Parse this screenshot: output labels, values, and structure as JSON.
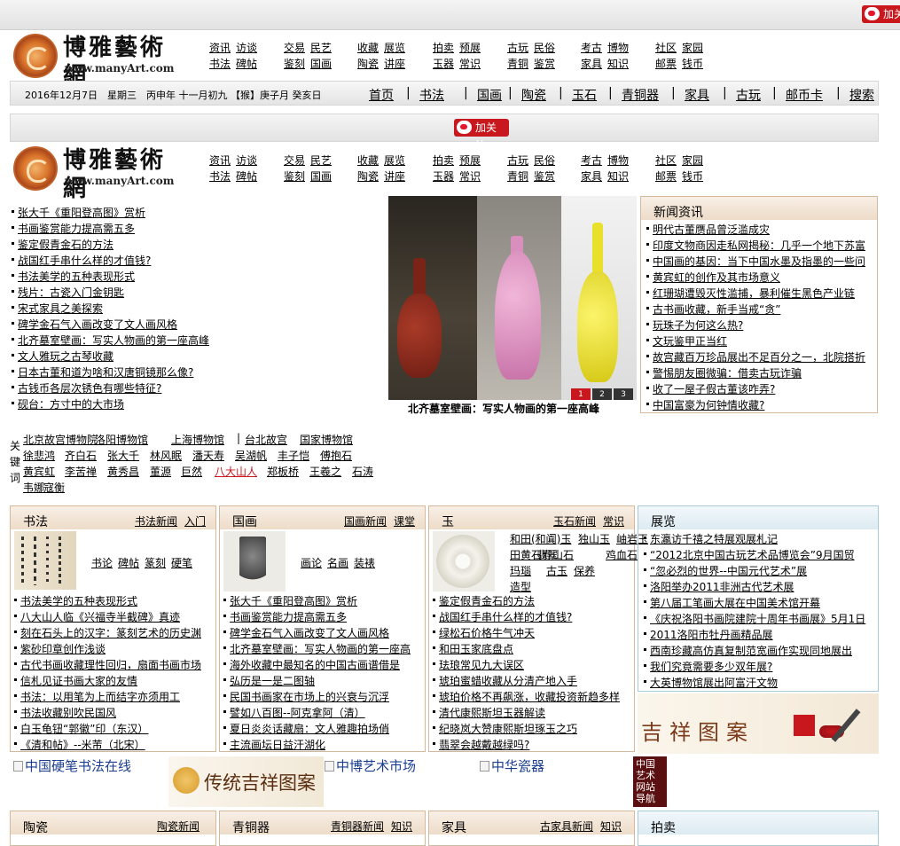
{
  "follow_label": "加关注",
  "follow_label_top": "加关",
  "logo": {
    "title": "博雅藝術網",
    "url": "www.manyArt.com"
  },
  "nav_columns": [
    [
      "资讯",
      "访谈",
      "书法",
      "碑帖"
    ],
    [
      "交易",
      "民艺",
      "鉴刻",
      "国画"
    ],
    [
      "收藏",
      "展览",
      "陶瓷",
      "讲座"
    ],
    [
      "拍卖",
      "预展",
      "玉器",
      "常识"
    ],
    [
      "古玩",
      "民俗",
      "青铜",
      "鉴赏"
    ],
    [
      "考古",
      "博物",
      "家具",
      "知识"
    ],
    [
      "社区",
      "家园",
      "邮票",
      "钱币"
    ]
  ],
  "date_text": "2016年12月7日　星期三　丙申年 十一月初九 【猴】庚子月 癸亥日",
  "top_nav": [
    "首页",
    "书法",
    "国画",
    "陶瓷",
    "玉石",
    "青铜器",
    "家具",
    "古玩",
    "邮币卡",
    "搜索"
  ],
  "left_list": [
    "张大千《重阳登高图》赏析",
    "书画鉴赏能力提高需五多",
    "鉴定假青金石的方法",
    "战国红手串什么样的才值钱?",
    "书法美学的五种表现形式",
    "残片：古瓷入门金钥匙",
    "宋式家具之美探索",
    "碑学金石气入画改变了文人画风格",
    "北齐墓室壁画：写实人物画的第一座高峰",
    "文人雅玩之古琴收藏",
    "日本古董和道为啥和汉唐铜镜那么像?",
    "古钱币各层次锈色有哪些特征?",
    "砚台：方寸中的大市场"
  ],
  "slider": {
    "caption": "北齐墓室壁画：写实人物画的第一座高峰",
    "dots": [
      "1",
      "2",
      "3"
    ]
  },
  "news": {
    "title": "新闻资讯",
    "items": [
      "明代古董赝品曾泛滥成灾",
      "印度文物商因走私网揭秘：几乎一个地下苏富",
      "中国画的基因：当下中国水墨及指墨的一些问",
      "黄宾虹的创作及其市场意义",
      "红珊瑚遭毁灭性滥捕，暴利催生黑色产业链",
      "古书画收藏，新手当戒“贪”",
      "玩珠子为何这么热?",
      "文玩鉴甲正当红",
      "故宫藏百万珍品展出不足百分之一，北院搭折",
      "警惕朋友圈微骗：借卖古玩诈骗",
      "收了一屋子假古董该咋弄?",
      "中国富豪为何钟情收藏?"
    ]
  },
  "keywords": {
    "label": "关键词",
    "items": [
      "北京故宫博物院",
      "洛阳博物馆",
      "上海博物馆",
      "",
      "台北故宫",
      "国家博物馆",
      "徐悲鸿",
      "齐白石",
      "张大千",
      "林风眠",
      "潘天寿",
      "吴湖帆",
      "丰子恺",
      "傅抱石",
      "黄宾虹",
      "李苦禅",
      "黄秀昌",
      "董源",
      "巨然",
      "八大山人",
      "郑板桥",
      "王羲之",
      "石涛",
      "韦娜",
      "寇衡"
    ]
  },
  "shufa": {
    "title": "书法",
    "links": [
      "书法新闻",
      "入门"
    ],
    "sub": [
      "书论",
      "碑帖",
      "篆刻",
      "硬笔"
    ],
    "items": [
      "书法美学的五种表现形式",
      "八大山人临《兴福寺半截碑》真迹",
      "刻在石头上的汉字：篆刻艺术的历史渊",
      "紫砂印章创作浅谈",
      "古代书画收藏理性回归，扇面书画市场",
      "信札见证书画大家的友情",
      "书法：以用笔为上而结字亦须用工",
      "书法收藏别吹民国风",
      "白玉龟钮“郭徽”印（东汉）",
      "《清和帖》--米芾（北宋）"
    ]
  },
  "guohua": {
    "title": "国画",
    "links": [
      "国画新闻",
      "课堂"
    ],
    "sub": [
      "画论",
      "名画",
      "装裱"
    ],
    "items": [
      "张大千《重阳登高图》赏析",
      "书画鉴赏能力提高需五多",
      "碑学金石气入画改变了文人画风格",
      "北齐墓室壁画：写实人物画的第一座高",
      "海外收藏中最知名的中国古画谱借是",
      "弘历是一是二图轴",
      "民国书画家在市场上的兴衰与沉浮",
      "譬如八百图--阿克拿阿（清）",
      "夏日炎炎话藏扇：文人雅趣拍场俏",
      "主流画坛日益汗湖化"
    ]
  },
  "yu": {
    "title": "玉",
    "links": [
      "玉石新闻",
      "常识"
    ],
    "sub": [
      "和田(和阗)玉",
      "独山玉",
      "岫岩玉",
      "田黄石寿山石",
      "翡翠",
      "鸡血石",
      "玛瑙",
      "古玉",
      "保养",
      "造型"
    ],
    "items": [
      "鉴定假青金石的方法",
      "战国红手串什么样的才值钱?",
      "绿松石价格牛气冲天",
      "和田玉家底盘点",
      "珐琅常见九大误区",
      "琥珀蜜蜡收藏从分清产地入手",
      "琥珀价格不再飙涨，收藏投资新趋多样",
      "清代康熙斯坦玉器解读",
      "纪晓岚大赞康熙斯坦琢玉之巧",
      "翡翠会越戴越绿吗?"
    ]
  },
  "zhanlan": {
    "title": "展览",
    "items": [
      "东瀛访千禧之特展观展札记",
      "“2012北京中国古玩艺术品博览会”9月国贸",
      "“忽必烈的世界--中国元代艺术”展",
      "洛阳举办2011非洲古代艺术展",
      "第八届工笔画大展在中国美术馆开幕",
      "《庆祝洛阳书画院建院十周年书画展》5月1日",
      "2011洛阳市牡丹画精品展",
      "西南珍藏高仿真复制范宽画作实现同地展出",
      "我们究竟需要多少双年展?",
      "大英博物馆展出阿富汗文物"
    ]
  },
  "banner_jixiang": "吉祥图案",
  "links_row": [
    "中国硬笔书法在线",
    "传统吉祥图案",
    "中博艺术市场",
    "中华瓷器"
  ],
  "side_box": "中国艺术网站导航",
  "bottom_panels": [
    {
      "title": "陶瓷",
      "links": [
        "陶瓷新闻"
      ]
    },
    {
      "title": "青铜器",
      "links": [
        "青铜器新闻",
        "知识"
      ]
    },
    {
      "title": "家具",
      "links": [
        "古家具新闻",
        "知识"
      ]
    },
    {
      "title": "拍卖",
      "links": []
    }
  ],
  "colors": {
    "accent_red": "#c8171d",
    "panel_brown": "#d6b89a",
    "panel_blue": "#a8c9d8",
    "link_blue": "#1a3d8f"
  }
}
